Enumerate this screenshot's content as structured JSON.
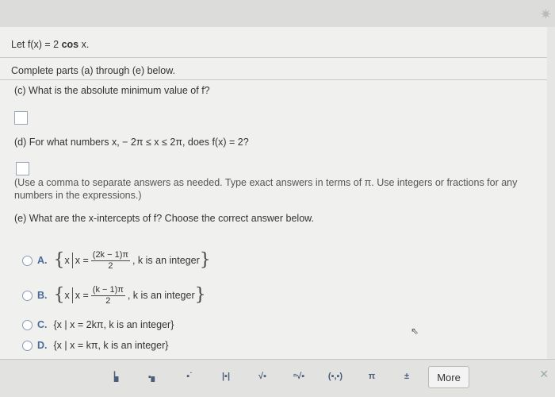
{
  "header": {
    "gear_icon": "gear-icon"
  },
  "problem": {
    "statement_prefix": "Let f(x) = 2 ",
    "statement_func": "cos",
    "statement_suffix": " x.",
    "instructions": "Complete parts (a) through (e) below.",
    "part_c": "(c) What is the absolute minimum value of f?",
    "part_d": "(d) For what numbers x,  − 2π ≤ x ≤ 2π, does f(x) = 2?",
    "hint": "(Use a comma to separate answers as needed. Type exact answers in terms of π. Use integers or fractions for any numbers in the expressions.)",
    "part_e": "(e) What are the x-intercepts of f? Choose the correct answer below."
  },
  "options": [
    {
      "letter": "A.",
      "lead": "x",
      "mid": "x =",
      "num": "(2k − 1)π",
      "den": "2",
      "tail": ", k is an integer"
    },
    {
      "letter": "B.",
      "lead": "x",
      "mid": "x =",
      "num": "(k − 1)π",
      "den": "2",
      "tail": ", k is an integer"
    },
    {
      "letter": "C.",
      "text": "{x | x = 2kπ, k is an integer}"
    },
    {
      "letter": "D.",
      "text": "{x | x = kπ, k is an integer}"
    }
  ],
  "toolbar": {
    "buttons": [
      "▕▖",
      "▪▖",
      "▪˙",
      "|▪|",
      "√▪",
      "ⁿ√▪",
      "(▪,▪)",
      "π",
      "±"
    ],
    "more_label": "More"
  }
}
